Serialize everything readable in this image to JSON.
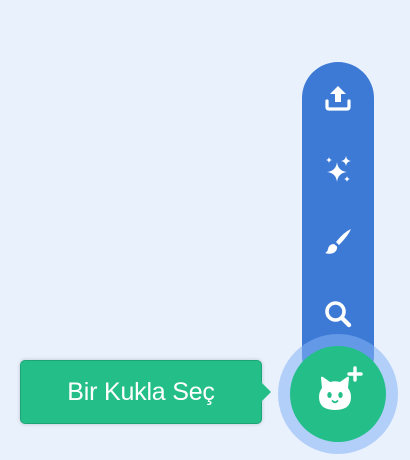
{
  "sprite_menu": {
    "items": [
      {
        "name": "upload-sprite",
        "icon": "upload-icon"
      },
      {
        "name": "surprise-sprite",
        "icon": "sparkles-icon"
      },
      {
        "name": "paint-sprite",
        "icon": "paintbrush-icon"
      },
      {
        "name": "search-sprite",
        "icon": "search-icon"
      }
    ],
    "main_button": {
      "icon": "cat-plus-icon"
    },
    "tooltip": "Bir Kukla Seç"
  },
  "colors": {
    "background": "#e9f1fc",
    "menu": "#3d7ad6",
    "accent": "#24bf89",
    "glow": "#85b2f8"
  }
}
